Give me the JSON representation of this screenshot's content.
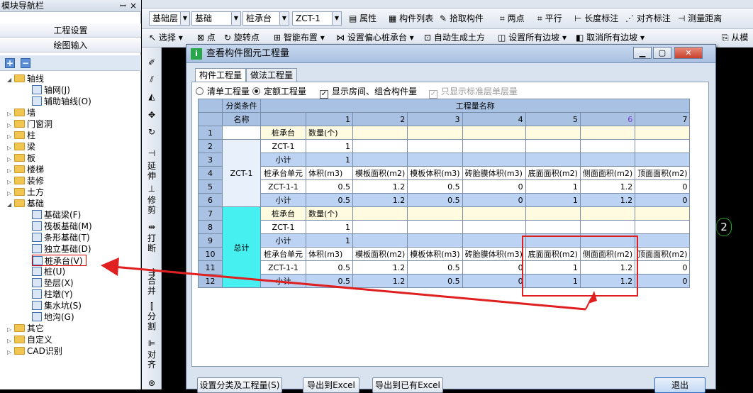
{
  "left_panel": {
    "title": "模块导航栏",
    "pin": "ꟷ",
    "close": "×",
    "btn_settings": "工程设置",
    "btn_draw": "绘图输入",
    "tool_add": "+",
    "tool_remove": "−",
    "tree": {
      "axis": "轴线",
      "axis_grid": "轴网(J)",
      "axis_aux": "辅助轴线(O)",
      "wall": "墙",
      "door": "门窗洞",
      "column": "柱",
      "beam": "梁",
      "slab": "板",
      "stair": "楼梯",
      "decor": "装修",
      "earth": "土方",
      "foundation": "基础",
      "f_beam": "基础梁(F)",
      "f_raft": "筏板基础(M)",
      "f_strip": "条形基础(T)",
      "f_isolated": "独立基础(D)",
      "f_pilecap": "桩承台(V)",
      "f_pile": "桩(U)",
      "f_cushion": "垫层(X)",
      "f_pier": "柱墩(Y)",
      "f_sump": "集水坑(S)",
      "f_trench": "地沟(G)",
      "other": "其它",
      "custom": "自定义",
      "cad": "CAD识别"
    }
  },
  "toolbar2": {
    "floor": "基础层",
    "category": "基础",
    "type": "桩承台",
    "member": "ZCT-1",
    "properties": "属性",
    "member_list": "构件列表",
    "pick_member": "拾取构件",
    "two_points": "两点",
    "parallel": "平行",
    "length_dim": "长度标注",
    "align_dim": "对齐标注",
    "measure": "测量距离"
  },
  "toolbar3": {
    "select": "选择",
    "point": "点",
    "rotate_point": "旋转点",
    "smart_place": "智能布置",
    "set_offset": "设置偏心桩承台",
    "auto_earth": "自动生成土方",
    "set_all_slopes": "设置所有边坡",
    "cancel_all_slopes": "取消所有边坡",
    "from": "从模"
  },
  "vtoolbar": {
    "extend": "延伸",
    "trim": "修剪",
    "break": "打断",
    "merge": "合并",
    "split": "分割",
    "align": "对齐"
  },
  "canvas": {
    "axis_label": "2"
  },
  "dialog": {
    "title": "查看构件图元工程量",
    "tab_member": "构件工程量",
    "tab_method": "做法工程量",
    "opt_list": "清单工程量",
    "opt_quota": "定额工程量",
    "opt_show_room": "显示房间、组合构件量",
    "opt_std_floor": "只显示标准层单层量",
    "hdr_category": "分类条件",
    "hdr_name": "名称",
    "hdr_qty_name": "工程量名称",
    "col_nums": [
      "1",
      "2",
      "3",
      "4",
      "5",
      "6",
      "7"
    ],
    "rows": [
      {
        "n": "1",
        "b": "桩承台",
        "c": "数量(个)",
        "d": "",
        "e": "",
        "f": "",
        "g": "",
        "h": "",
        "i": ""
      },
      {
        "n": "2",
        "b": "ZCT-1",
        "c": "1",
        "d": "",
        "e": "",
        "f": "",
        "g": "",
        "h": "",
        "i": ""
      },
      {
        "n": "3",
        "b": "小计",
        "c": "1",
        "d": "",
        "e": "",
        "f": "",
        "g": "",
        "h": "",
        "i": ""
      },
      {
        "n": "4",
        "b": "桩承台单元",
        "c": "体积(m3)",
        "d": "模板面积(m2)",
        "e": "模板体积(m3)",
        "f": "砖胎膜体积(m3)",
        "g": "底面面积(m2)",
        "h": "侧面面积(m2)",
        "i": "顶面面积(m2)"
      },
      {
        "n": "5",
        "b": "ZCT-1-1",
        "c": "0.5",
        "d": "1.2",
        "e": "0.5",
        "f": "0",
        "g": "1",
        "h": "1.2",
        "i": "0"
      },
      {
        "n": "6",
        "b": "小计",
        "c": "0.5",
        "d": "1.2",
        "e": "0.5",
        "f": "0",
        "g": "1",
        "h": "1.2",
        "i": "0"
      },
      {
        "n": "7",
        "b": "桩承台",
        "c": "数量(个)",
        "d": "",
        "e": "",
        "f": "",
        "g": "",
        "h": "",
        "i": ""
      },
      {
        "n": "8",
        "b": "ZCT-1",
        "c": "1",
        "d": "",
        "e": "",
        "f": "",
        "g": "",
        "h": "",
        "i": ""
      },
      {
        "n": "9",
        "b": "小计",
        "c": "1",
        "d": "",
        "e": "",
        "f": "",
        "g": "",
        "h": "",
        "i": ""
      },
      {
        "n": "10",
        "b": "桩承台单元",
        "c": "体积(m3)",
        "d": "模板面积(m2)",
        "e": "模板体积(m3)",
        "f": "砖胎膜体积(m3)",
        "g": "底面面积(m2)",
        "h": "侧面面积(m2)",
        "i": "顶面面积(m2)"
      },
      {
        "n": "11",
        "b": "ZCT-1-1",
        "c": "0.5",
        "d": "1.2",
        "e": "0.5",
        "f": "0",
        "g": "1",
        "h": "1.2",
        "i": "0"
      },
      {
        "n": "12",
        "b": "小计",
        "c": "0.5",
        "d": "1.2",
        "e": "0.5",
        "f": "0",
        "g": "1",
        "h": "1.2",
        "i": "0"
      }
    ],
    "group_a": "ZCT-1",
    "group_b": "总计",
    "btn_set_category": "设置分类及工程量(S)",
    "btn_export_excel": "导出到Excel",
    "btn_export_existing": "导出到已有Excel",
    "btn_exit": "退出"
  },
  "colors": {
    "annotation_red": "#e02020",
    "total_group": "#47f0f0",
    "header_blue": "#a9c2e3",
    "subtotal_blue": "#bcd3f3"
  }
}
